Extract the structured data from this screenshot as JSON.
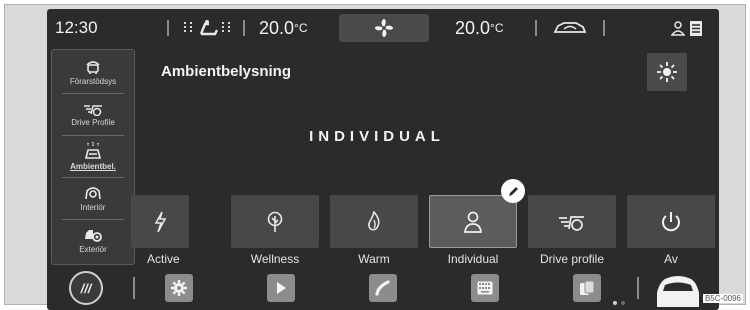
{
  "status_bar": {
    "time": "12:30",
    "temp_left": "20.0",
    "temp_right": "20.0",
    "temp_unit": "°C",
    "fan_icon": "fan-icon",
    "seat_icon": "seat-heating-icon",
    "car_icon": "car-recirculation-icon",
    "profile_icon": "user-profile-icon",
    "notes_icon": "notes-icon"
  },
  "sidebar": {
    "items": [
      {
        "label": "Förarstödsys",
        "icon": "driver-assist-icon"
      },
      {
        "label": "Drive Profile",
        "icon": "drive-profile-icon"
      },
      {
        "label": "Ambientbel.",
        "icon": "ambient-light-icon",
        "active": true
      },
      {
        "label": "Interiör",
        "icon": "interior-icon"
      },
      {
        "label": "Exteriör",
        "icon": "exterior-icon"
      }
    ]
  },
  "main": {
    "title": "Ambientbelysning",
    "mode_label": "INDIVIDUAL",
    "brightness_icon": "sun-icon",
    "modes": [
      {
        "label": "Active",
        "icon": "lightning-icon"
      },
      {
        "label": "Wellness",
        "icon": "tree-icon"
      },
      {
        "label": "Warm",
        "icon": "flame-icon"
      },
      {
        "label": "Individual",
        "icon": "person-icon",
        "selected": true
      },
      {
        "label": "Drive profile",
        "icon": "drive-profile-icon"
      },
      {
        "label": "Av",
        "icon": "power-icon"
      }
    ]
  },
  "dock": {
    "home": "///",
    "items": [
      "settings-icon",
      "play-icon",
      "phone-icon",
      "keyboard-icon",
      "app-connect-icon"
    ],
    "vehicle_icon": "vehicle-icon"
  },
  "reference_code": "B5C-0096",
  "colors": {
    "screen_bg": "#2b2b2b",
    "tile_bg": "#484848",
    "dock_button": "#8c8c8c",
    "text": "#ececec"
  }
}
